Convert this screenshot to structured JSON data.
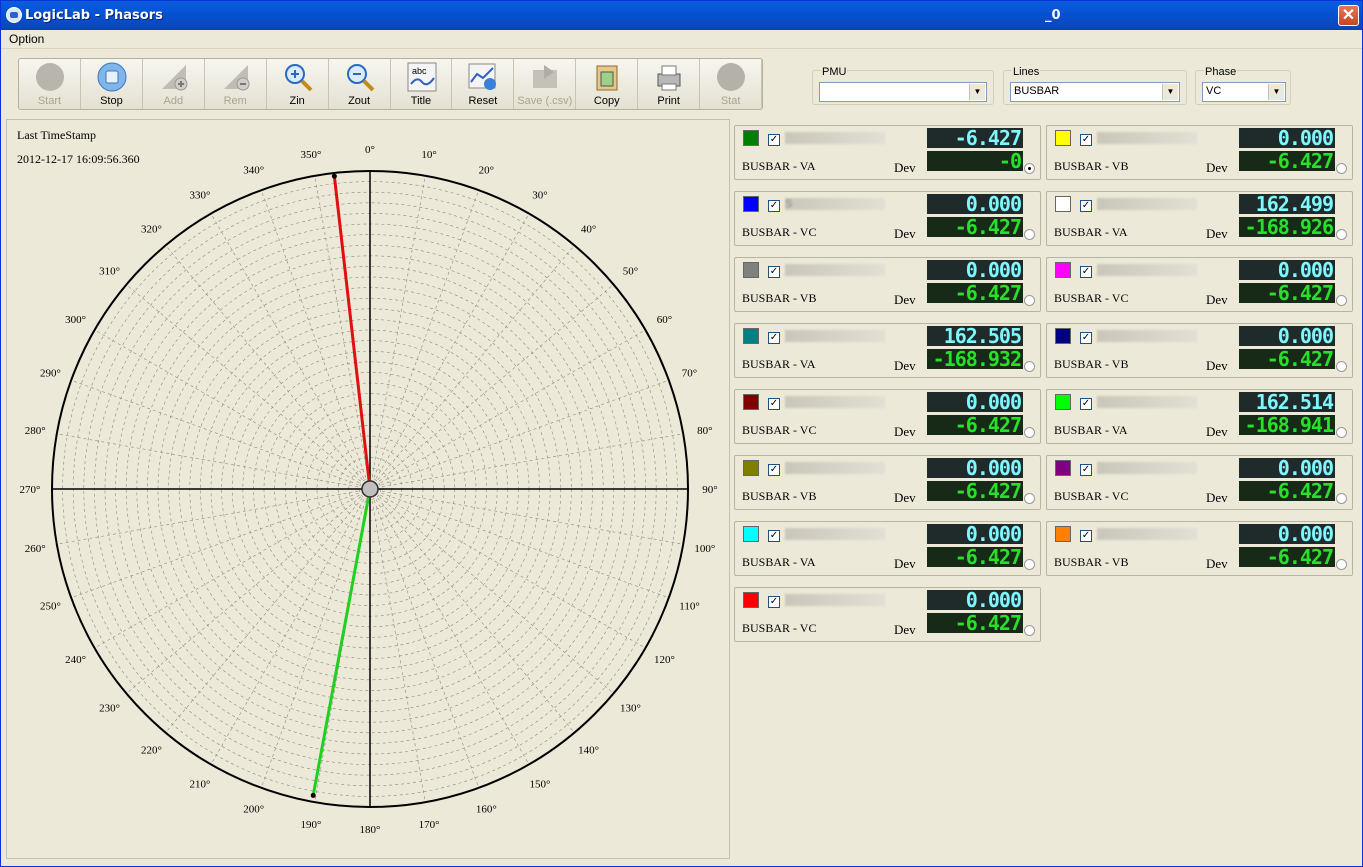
{
  "window": {
    "title": "LogicLab - Phasors",
    "title_suffix": "_0",
    "close_glyph": "✕"
  },
  "menu": {
    "option": "Option"
  },
  "toolbar": [
    {
      "label": "Start",
      "icon": "start-icon",
      "enabled": false
    },
    {
      "label": "Stop",
      "icon": "stop-icon",
      "enabled": true
    },
    {
      "label": "Add",
      "icon": "add-icon",
      "enabled": false
    },
    {
      "label": "Rem",
      "icon": "remove-icon",
      "enabled": false
    },
    {
      "label": "Zin",
      "icon": "zoom-in-icon",
      "enabled": true
    },
    {
      "label": "Zout",
      "icon": "zoom-out-icon",
      "enabled": true
    },
    {
      "label": "Title",
      "icon": "title-icon",
      "enabled": true
    },
    {
      "label": "Reset",
      "icon": "reset-icon",
      "enabled": true
    },
    {
      "label": "Save (.csv)",
      "icon": "save-icon",
      "enabled": false
    },
    {
      "label": "Copy",
      "icon": "copy-icon",
      "enabled": true
    },
    {
      "label": "Print",
      "icon": "print-icon",
      "enabled": true
    },
    {
      "label": "Stat",
      "icon": "stat-icon",
      "enabled": false
    }
  ],
  "selectors": {
    "pmu": {
      "legend": "PMU",
      "value": ""
    },
    "lines": {
      "legend": "Lines",
      "value": "BUSBAR"
    },
    "phase": {
      "legend": "Phase",
      "value": "VC"
    }
  },
  "timestamp": {
    "label": "Last TimeStamp",
    "value": "2012-12-17 16:09:56.360"
  },
  "polar": {
    "angle_labels": [
      "0°",
      "10°",
      "20°",
      "30°",
      "40°",
      "50°",
      "60°",
      "70°",
      "80°",
      "90°",
      "100°",
      "110°",
      "120°",
      "130°",
      "140°",
      "150°",
      "160°",
      "170°",
      "180°",
      "190°",
      "200°",
      "210°",
      "220°",
      "230°",
      "240°",
      "250°",
      "260°",
      "270°",
      "280°",
      "290°",
      "300°",
      "310°",
      "320°",
      "330°",
      "340°",
      "350°"
    ],
    "phasors": [
      {
        "angle_deg": 353.5,
        "magnitude": 0.99,
        "color": "#e01010"
      },
      {
        "angle_deg": 190.5,
        "magnitude": 0.98,
        "color": "#20d020"
      }
    ]
  },
  "dev_label": "Dev",
  "cards": [
    {
      "color": "#007f00",
      "label": "BUSBAR - VA",
      "top": "-6.427",
      "bottom": "-0",
      "radio": true,
      "name_text": ""
    },
    {
      "color": "#ffff00",
      "label": "BUSBAR - VB",
      "top": "0.000",
      "bottom": "-6.427",
      "radio": false,
      "name_text": ""
    },
    {
      "color": "#0000ff",
      "label": "BUSBAR - VC",
      "top": "0.000",
      "bottom": "-6.427",
      "radio": false,
      "name_text": "S"
    },
    {
      "color": "#ffffff",
      "label": "BUSBAR - VA",
      "top": "162.499",
      "bottom": "-168.926",
      "radio": false,
      "name_text": ""
    },
    {
      "color": "#808080",
      "label": "BUSBAR - VB",
      "top": "0.000",
      "bottom": "-6.427",
      "radio": false,
      "name_text": ""
    },
    {
      "color": "#ff00ff",
      "label": "BUSBAR - VC",
      "top": "0.000",
      "bottom": "-6.427",
      "radio": false,
      "name_text": ""
    },
    {
      "color": "#008080",
      "label": "BUSBAR - VA",
      "top": "162.505",
      "bottom": "-168.932",
      "radio": false,
      "name_text": ""
    },
    {
      "color": "#000080",
      "label": "BUSBAR - VB",
      "top": "0.000",
      "bottom": "-6.427",
      "radio": false,
      "name_text": ""
    },
    {
      "color": "#800000",
      "label": "BUSBAR - VC",
      "top": "0.000",
      "bottom": "-6.427",
      "radio": false,
      "name_text": ""
    },
    {
      "color": "#00ff00",
      "label": "BUSBAR - VA",
      "top": "162.514",
      "bottom": "-168.941",
      "radio": false,
      "name_text": ""
    },
    {
      "color": "#808000",
      "label": "BUSBAR - VB",
      "top": "0.000",
      "bottom": "-6.427",
      "radio": false,
      "name_text": ""
    },
    {
      "color": "#800080",
      "label": "BUSBAR - VC",
      "top": "0.000",
      "bottom": "-6.427",
      "radio": false,
      "name_text": ""
    },
    {
      "color": "#00ffff",
      "label": "BUSBAR - VA",
      "top": "0.000",
      "bottom": "-6.427",
      "radio": false,
      "name_text": ""
    },
    {
      "color": "#ff8000",
      "label": "BUSBAR - VB",
      "top": "0.000",
      "bottom": "-6.427",
      "radio": false,
      "name_text": ""
    },
    {
      "color": "#ff0000",
      "label": "BUSBAR - VC",
      "top": "0.000",
      "bottom": "-6.427",
      "radio": false,
      "name_text": ""
    }
  ]
}
